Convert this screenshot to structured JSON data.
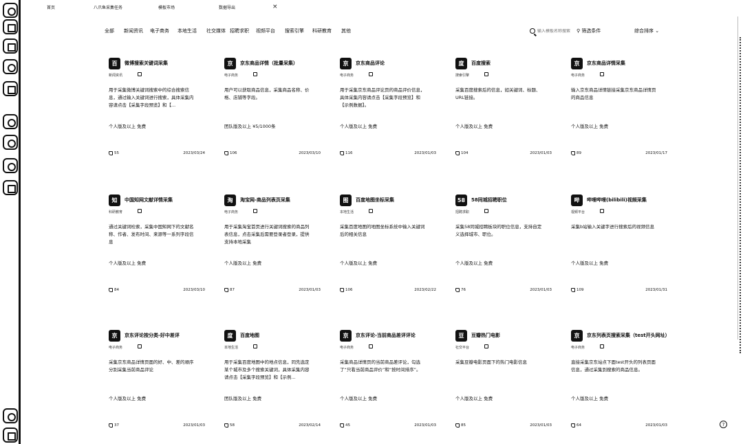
{
  "tabs": [
    {
      "label": "首页"
    },
    {
      "label": "八爪鱼采集任务"
    },
    {
      "label": "模板市场"
    },
    {
      "label": "数据导出"
    }
  ],
  "categories": [
    "全部",
    "新闻资讯",
    "电子商务",
    "本地生活",
    "社交媒体",
    "招聘求职",
    "视频平台",
    "搜索引擎",
    "科研教育",
    "其他"
  ],
  "search": {
    "placeholder": "输入模板名称搜索"
  },
  "filter_label": "筛选条件",
  "sort_label": "综合排序",
  "cards": [
    {
      "icon": "百",
      "icon_name": "baidu-icon",
      "title": "微博搜索关键词采集",
      "tag": "新闻资讯",
      "desc": "用于采集微博关键词搜索中的综合搜索信息，通过输入关键词进行搜索，具体采集内容请点击【采集字段预览】和【...",
      "price": "个人版及以上 免费",
      "likes": "55",
      "date": "2023/03/24"
    },
    {
      "icon": "京",
      "icon_name": "jd-icon",
      "title": "京东商品详情（批量采集）",
      "tag": "电子商务",
      "desc": "用户可以获取商品信息，采集商品名称、价格、店铺等字段。",
      "price": "团队版及以上 ¥5/1000条",
      "likes": "106",
      "date": "2023/03/10"
    },
    {
      "icon": "京",
      "icon_name": "jd-icon",
      "title": "京东商品评论",
      "tag": "电子商务",
      "desc": "用于采集京东商品评论页的商品评价信息，具体采集内容请点击【采集字段预览】和【示例数据】。",
      "price": "个人版及以上 免费",
      "likes": "116",
      "date": "2023/01/03"
    },
    {
      "icon": "度",
      "icon_name": "baidu-paw-icon",
      "title": "百度搜索",
      "tag": "搜索引擎",
      "desc": "采集百度搜索后的信息，如关键词、标题、URL链接。",
      "price": "个人版及以上 免费",
      "likes": "104",
      "date": "2023/01/03"
    },
    {
      "icon": "京",
      "icon_name": "jd-icon",
      "title": "京东商品详情采集",
      "tag": "电子商务",
      "desc": "输入京东商品详情链接采集京东商品详情页的商品信息",
      "price": "个人版及以上 免费",
      "likes": "89",
      "date": "2023/01/17"
    },
    {
      "icon": "知",
      "icon_name": "cnki-icon",
      "title": "中国知网文献详情采集",
      "tag": "科研教育",
      "desc": "通过关键词检索，采集中国知网下的文献名称、作者、发布时间、来源等一系列字段信息",
      "price": "个人版及以上 免费",
      "likes": "84",
      "date": "2023/03/10"
    },
    {
      "icon": "淘",
      "icon_name": "taobao-icon",
      "title": "淘宝网-商品列表页采集",
      "tag": "电子商务",
      "desc": "用于采集淘宝首页进行关键词搜索的商品列表信息，点击采集后需要登录者登录，提供支持本地采集",
      "price": "个人版及以上 免费",
      "likes": "87",
      "date": "2023/01/03"
    },
    {
      "icon": "图",
      "icon_name": "baidu-map-icon",
      "title": "百度地图坐标采集",
      "tag": "本地生活",
      "desc": "采集百度地图的地图坐标系统中输入关键词后的相关信息",
      "price": "个人版及以上 免费",
      "likes": "106",
      "date": "2023/02/22"
    },
    {
      "icon": "58",
      "icon_name": "58-icon",
      "title": "58同城招聘职位",
      "tag": "招聘求职",
      "desc": "采集58同城招聘板块的职位信息，支持自定义选择城市、职位。",
      "price": "个人版及以上 免费",
      "likes": "76",
      "date": "2023/01/03"
    },
    {
      "icon": "哔",
      "icon_name": "bilibili-icon",
      "title": "哔哩哔哩(bilibili)视频采集",
      "tag": "视频平台",
      "desc": "采集b站输入关键字进行搜索后的视频信息",
      "price": "个人版及以上 免费",
      "likes": "109",
      "date": "2023/01/31"
    },
    {
      "icon": "京",
      "icon_name": "jd-icon",
      "title": "京东评论按分类-好中差评",
      "tag": "电子商务",
      "desc": "采集京东商品详情页面的好、中、差的顺序分别采集当前商品评论",
      "price": "个人版及以上 免费",
      "likes": "37",
      "date": "2023/01/03"
    },
    {
      "icon": "度",
      "icon_name": "baidu-paw-icon",
      "title": "百度地图",
      "tag": "本地生活",
      "desc": "用于采集百度地图中的地点信息，同先选定某个城市及多个搜索关键词，具体采集内容请点击【采集字段预览】和【示例...",
      "price": "团队版及以上 免费",
      "likes": "58",
      "date": "2023/02/14"
    },
    {
      "icon": "京",
      "icon_name": "jd-icon",
      "title": "京东评论-当前商品差评评论",
      "tag": "电子商务",
      "desc": "采集商品详情页的当前商品差评论，勾选了“只看当前商品评价”和“按时间排序”。",
      "price": "个人版及以上 免费",
      "likes": "45",
      "date": "2023/01/03"
    },
    {
      "icon": "豆",
      "icon_name": "douban-icon",
      "title": "豆瓣热门电影",
      "tag": "社交平台",
      "desc": "采集豆瓣电影页面下的热门电影信息",
      "price": "个人版及以上 免费",
      "likes": "85",
      "date": "2023/01/03"
    },
    {
      "icon": "京",
      "icon_name": "jd-icon",
      "title": "京东列表页搜索采集（test开头网址）",
      "tag": "电子商务",
      "desc": "直接采集京东站点下面test开头的列表页面信息，通过采集到搜索的商品信息。",
      "price": "个人版及以上 免费",
      "likes": "64",
      "date": "2023/01/03"
    }
  ]
}
